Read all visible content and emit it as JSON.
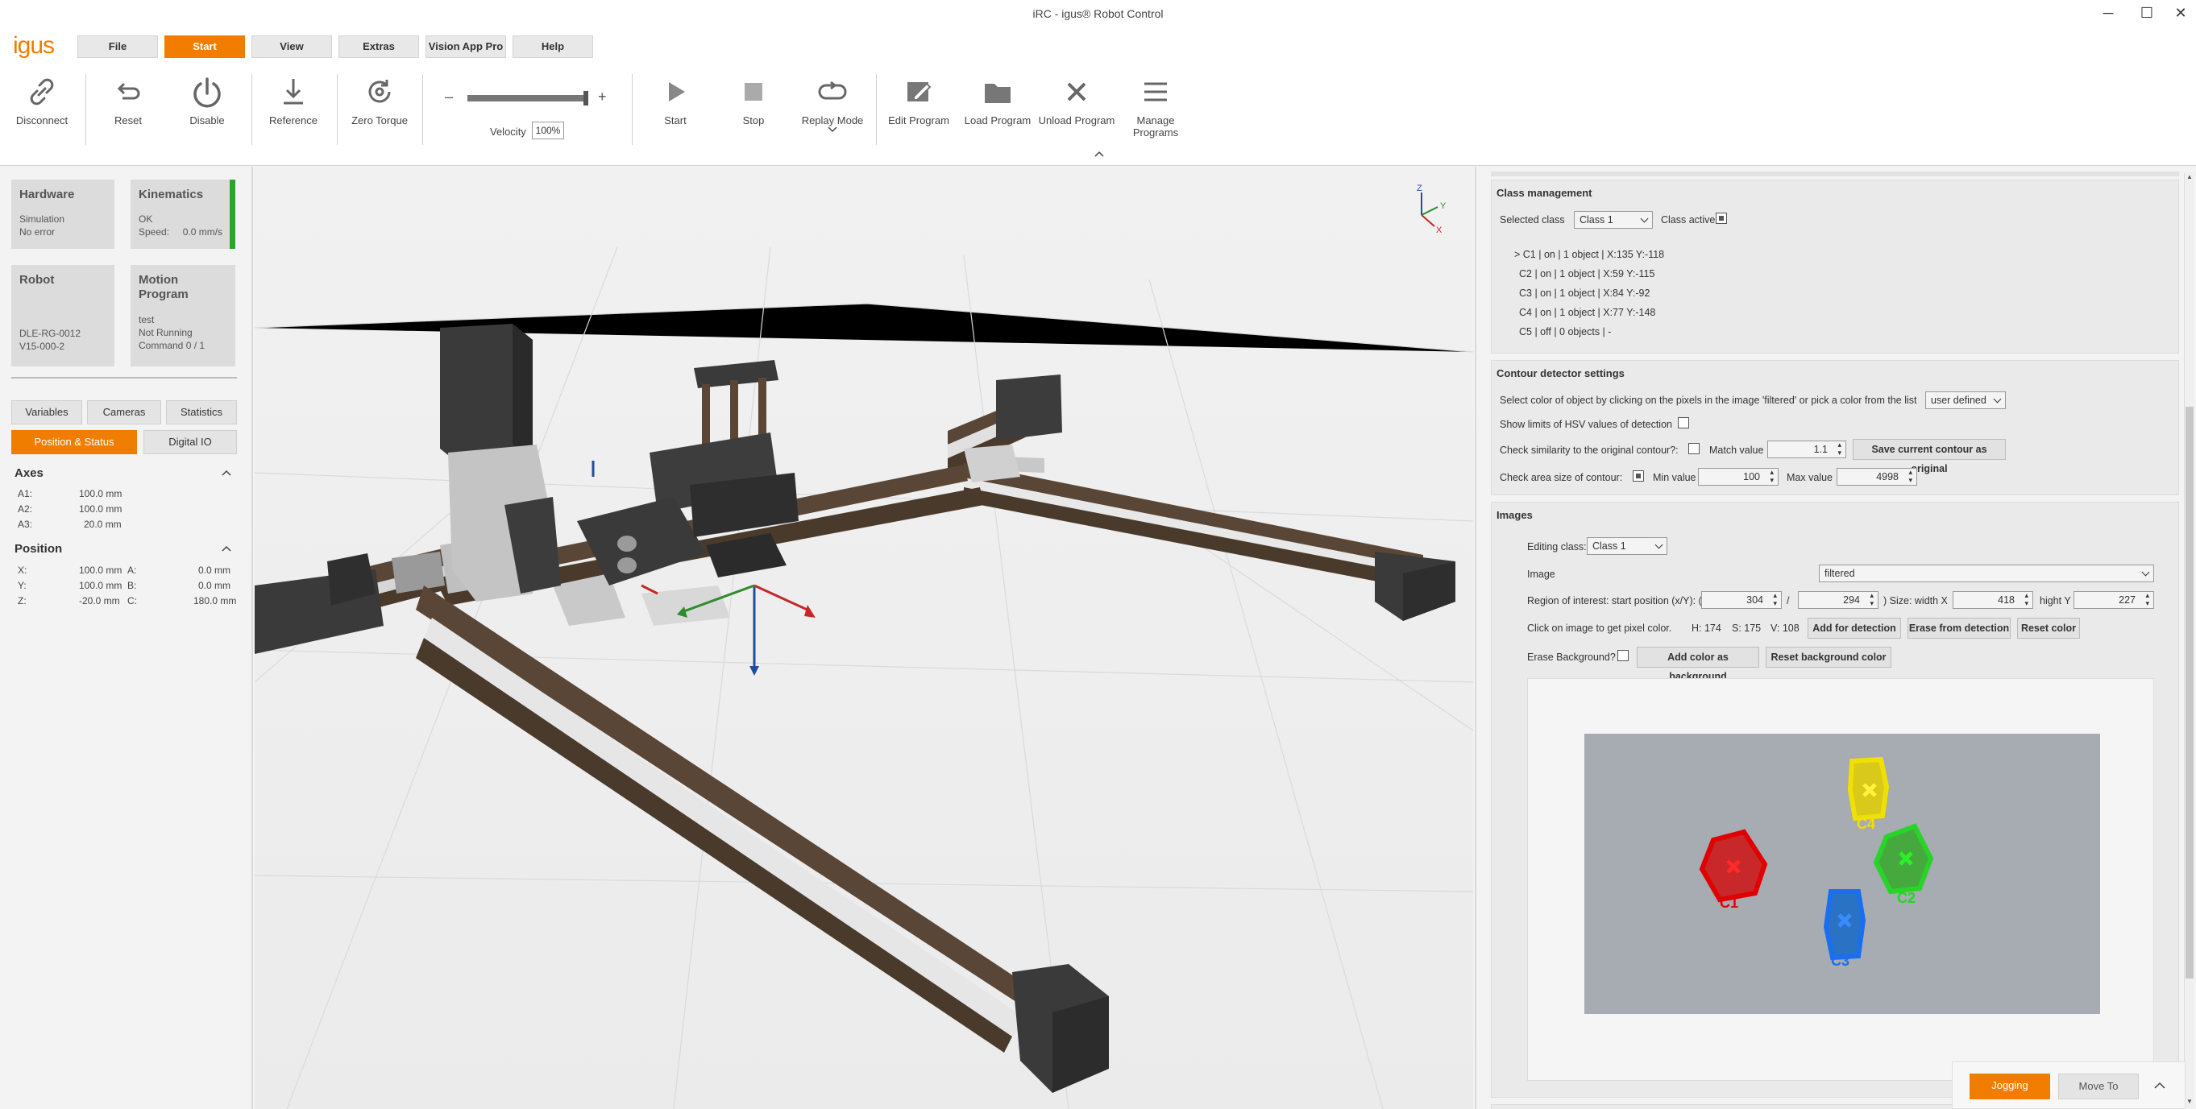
{
  "window": {
    "title": "iRC - igus® Robot Control",
    "minimize": "─",
    "maximize": "☐",
    "close": "✕"
  },
  "logo": "igus",
  "menu": {
    "tabs": [
      "File",
      "Start",
      "View",
      "Extras",
      "Vision App Pro",
      "Help"
    ],
    "active": "Start"
  },
  "ribbon": {
    "disconnect": "Disconnect",
    "reset": "Reset",
    "disable": "Disable",
    "reference": "Reference",
    "zero_torque": "Zero Torque",
    "velocity_label": "Velocity",
    "velocity_value": "100%",
    "velocity_minus": "–",
    "velocity_plus": "+",
    "velocity_fraction": 1.0,
    "start": "Start",
    "stop": "Stop",
    "replay_mode": "Replay Mode",
    "edit_program": "Edit Program",
    "load_program": "Load Program",
    "unload_program": "Unload Program",
    "manage_programs_1": "Manage",
    "manage_programs_2": "Programs"
  },
  "status": {
    "hardware": {
      "title": "Hardware",
      "line1": "Simulation",
      "line2": "No error"
    },
    "kinematics": {
      "title": "Kinematics",
      "line1": "OK",
      "speed_label": "Speed:",
      "speed_value": "0.0 mm/s",
      "indicator_color": "#2aa52a"
    },
    "robot": {
      "title": "Robot",
      "line1": "DLE-RG-0012",
      "line2": "V15-000-2"
    },
    "motion": {
      "title1": "Motion",
      "title2": "Program",
      "line1": "test",
      "line2": "Not Running",
      "line3": "Command 0 / 1"
    }
  },
  "left_tabs": [
    "Variables",
    "Cameras",
    "Statistics",
    "Position & Status",
    "Digital IO"
  ],
  "axes": {
    "title": "Axes",
    "rows": [
      {
        "k": "A1:",
        "v": "100.0 mm"
      },
      {
        "k": "A2:",
        "v": "100.0 mm"
      },
      {
        "k": "A3:",
        "v": "20.0 mm"
      }
    ]
  },
  "position": {
    "title": "Position",
    "rows": [
      {
        "k1": "X:",
        "v1": "100.0 mm",
        "k2": "A:",
        "v2": "0.0 mm"
      },
      {
        "k1": "Y:",
        "v1": "100.0 mm",
        "k2": "B:",
        "v2": "0.0 mm"
      },
      {
        "k1": "Z:",
        "v1": "-20.0 mm",
        "k2": "C:",
        "v2": "180.0 mm"
      }
    ]
  },
  "axis_gizmo": {
    "z": "Z",
    "y": "Y",
    "x": "X"
  },
  "class_mgmt": {
    "title": "Class management",
    "selected_label": "Selected class",
    "selected_value": "Class 1",
    "active_label": "Class active",
    "items": [
      "> C1 | on | 1 object | X:135 Y:-118",
      "C2 | on | 1 object | X:59 Y:-115",
      "C3 | on | 1 object | X:84 Y:-92",
      "C4 | on | 1 object | X:77 Y:-148",
      "C5 | off | 0 objects | -"
    ]
  },
  "contour": {
    "title": "Contour detector settings",
    "select_color": "Select color of object by clicking on the pixels in the image 'filtered' or pick a color from the list",
    "color_value": "user defined",
    "show_hsv": "Show limits of HSV values of detection",
    "check_similarity": "Check similarity to the original contour?:",
    "match_label": "Match value",
    "match_value": "1.1",
    "save_btn": "Save current contour as original",
    "check_area": "Check area size of contour:",
    "min_label": "Min value",
    "min_value": "100",
    "max_label": "Max value",
    "max_value": "4998"
  },
  "images": {
    "title": "Images",
    "editing_label": "Editing class:",
    "editing_value": "Class 1",
    "image_label": "Image",
    "image_value": "filtered",
    "roi_label": "Region of interest: start position (x/Y): (",
    "roi_x": "304",
    "roi_slash": "/",
    "roi_y": "294",
    "size_label": ") Size: width X",
    "size_w": "418",
    "height_label": "hight Y",
    "size_h": "227",
    "pixel_label": "Click on image to get pixel color.",
    "pixel_h": "H:  174",
    "pixel_s": "S:  175",
    "pixel_v": "V:  108",
    "add_detection": "Add for detection",
    "erase_detection": "Erase from detection",
    "reset_color": "Reset color",
    "erase_bg": "Erase Background?",
    "add_bg": "Add color as background",
    "reset_bg": "Reset background color",
    "labels": [
      "C1",
      "C2",
      "C3",
      "C4"
    ]
  },
  "bottom": {
    "jogging": "Jogging",
    "move_to": "Move To",
    "collapse": "^"
  }
}
